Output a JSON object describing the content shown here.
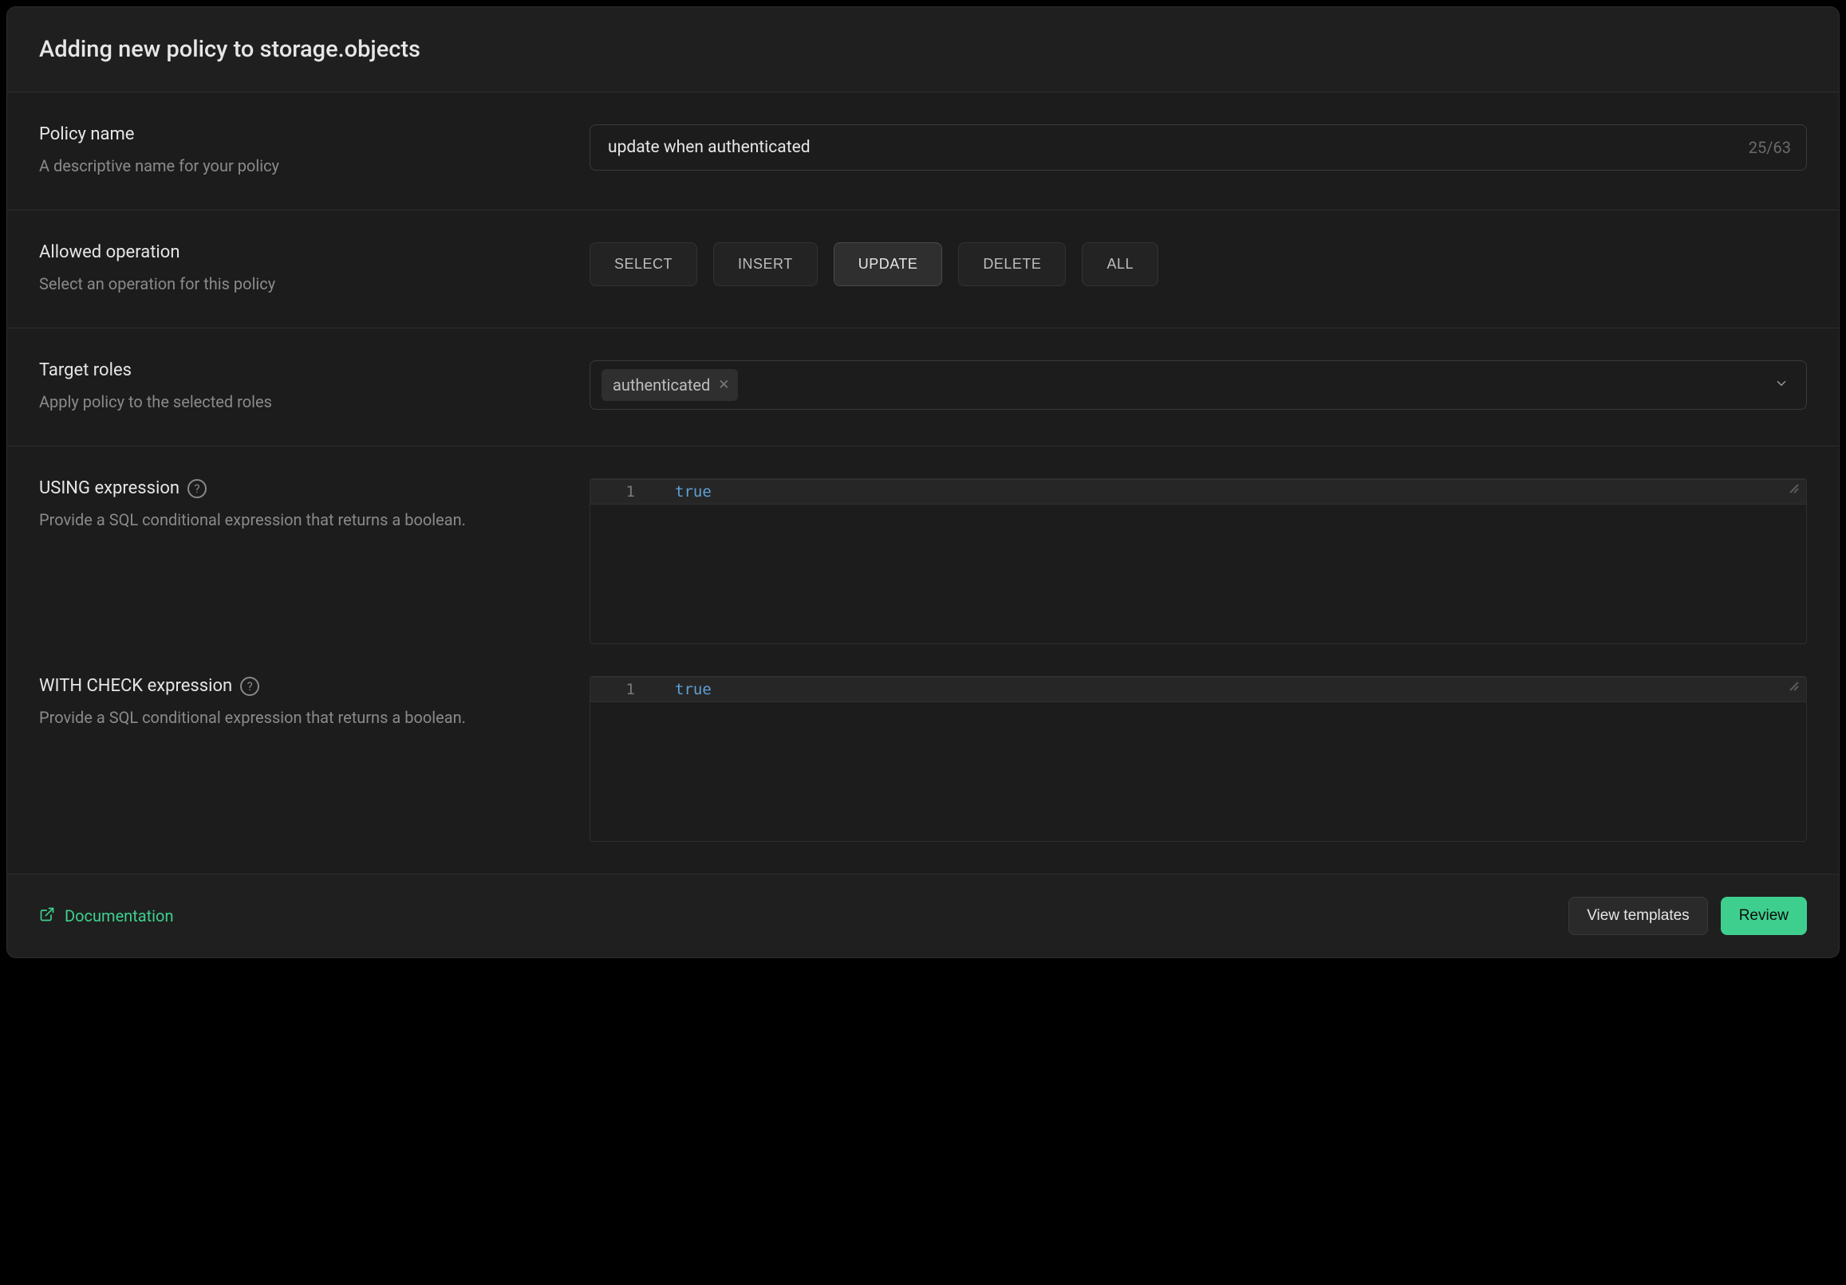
{
  "header": {
    "title": "Adding new policy to storage.objects"
  },
  "policy_name": {
    "label": "Policy name",
    "desc": "A descriptive name for your policy",
    "value": "update when authenticated",
    "counter": "25/63"
  },
  "allowed_op": {
    "label": "Allowed operation",
    "desc": "Select an operation for this policy",
    "options": [
      "SELECT",
      "INSERT",
      "UPDATE",
      "DELETE",
      "ALL"
    ],
    "selected": "UPDATE"
  },
  "target_roles": {
    "label": "Target roles",
    "desc": "Apply policy to the selected roles",
    "chips": [
      "authenticated"
    ]
  },
  "using_expr": {
    "label": "USING expression",
    "desc": "Provide a SQL conditional expression that returns a boolean.",
    "line_num": "1",
    "code": "true"
  },
  "check_expr": {
    "label": "WITH CHECK expression",
    "desc": "Provide a SQL conditional expression that returns a boolean.",
    "line_num": "1",
    "code": "true"
  },
  "footer": {
    "doc_label": "Documentation",
    "view_templates": "View templates",
    "review": "Review"
  }
}
